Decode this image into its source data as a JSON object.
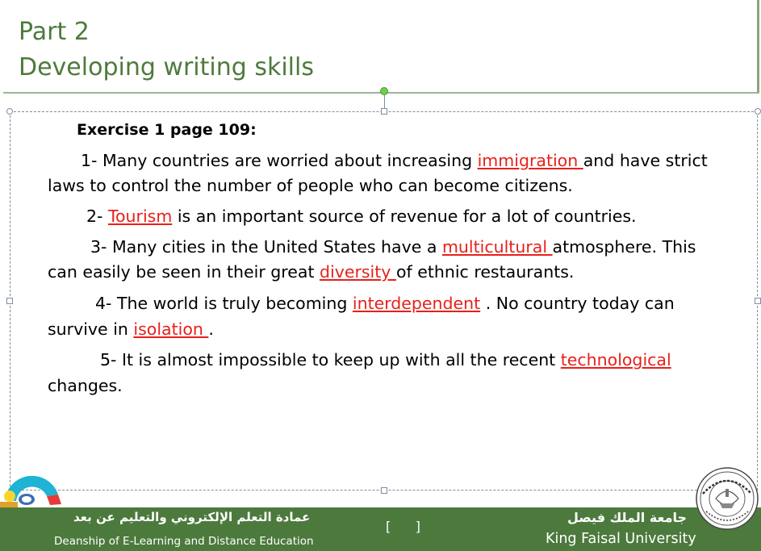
{
  "header": {
    "title_line1": "Part 2",
    "title_line2": "Developing writing skills"
  },
  "exercise": {
    "title": "Exercise 1 page 109:",
    "items": [
      {
        "pre": "1- Many countries are worried about increasing ",
        "answer": "immigration ",
        "post": "and have strict",
        "cont": "laws to control the number of people who can become citizens."
      },
      {
        "pre": "2- ",
        "answer": "Tourism",
        "post": " is an important source of revenue for a lot of countries."
      },
      {
        "pre": "3- Many cities in the United States have a ",
        "answer": "multicultural ",
        "post": "atmosphere. This",
        "cont_pre": "can easily be seen in their great ",
        "cont_answer": "diversity ",
        "cont_post": "of ethnic restaurants."
      },
      {
        "pre": "4- The world is truly becoming  ",
        "answer": "interdependent",
        "post": " . No country today can",
        "cont_pre": "survive in ",
        "cont_answer": "isolation ",
        "cont_post": " ."
      },
      {
        "pre": "5- It is almost impossible to keep up with all the recent ",
        "answer": "technological",
        "cont": "changes."
      }
    ]
  },
  "footer": {
    "deanship_ar": "عمادة التعلم الإلكتروني والتعليم عن بعد",
    "deanship_en": "Deanship of E-Learning and Distance Education",
    "slide_number": "[      ]",
    "university_ar": "جامعة الملك فيصل",
    "university_en": "King Faisal University"
  },
  "colors": {
    "title_green": "#4e7a3c",
    "answer_red": "#e8201b",
    "footer_green": "#4c7a3d",
    "selection_gray": "#7f8ca0"
  },
  "icons": {
    "seal": "university-seal-icon",
    "logo": "elearning-logo-icon"
  }
}
